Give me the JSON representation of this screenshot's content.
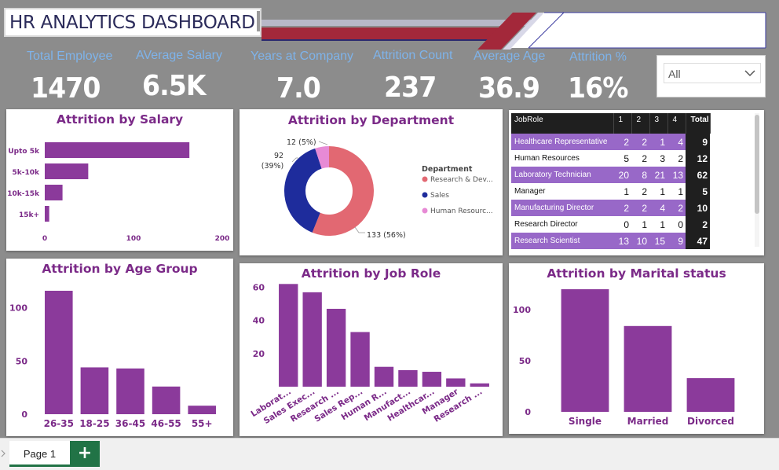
{
  "header": {
    "title": "HR ANALYTICS DASHBOARD"
  },
  "kpis": [
    {
      "label": "Total Employee",
      "value": "1470"
    },
    {
      "label": "AVerage Salary",
      "value": "6.5K"
    },
    {
      "label": "Years at Company",
      "value": "7.0"
    },
    {
      "label": "Attrition Count",
      "value": "237"
    },
    {
      "label": "Average  Age",
      "value": "36.9"
    },
    {
      "label": "Attrition %",
      "value": "16%"
    }
  ],
  "slicer": {
    "selected": "All",
    "icon": "chevron-down-icon"
  },
  "colors": {
    "bar": "#8b3a9b",
    "title": "#7b2a88",
    "rnd": "#e26872",
    "sales": "#1e2c9c",
    "hr": "#e78ad5",
    "accent_red": "#a3283a"
  },
  "salary_chart": {
    "chart_data": {
      "type": "bar",
      "orientation": "horizontal",
      "title": "Attrition by Salary",
      "categories": [
        "Upto 5k",
        "5k-10k",
        "10k-15k",
        "15k+"
      ],
      "values": [
        163,
        49,
        20,
        5
      ],
      "xlim": [
        0,
        200
      ],
      "ticks": [
        "0",
        "100",
        "200"
      ],
      "xlabel": "",
      "ylabel": ""
    }
  },
  "department_chart": {
    "chart_data": {
      "type": "pie",
      "donut": true,
      "title": "Attrition by Department",
      "legend_title": "Department",
      "categories": [
        "Research & Dev...",
        "Sales",
        "Human Resourc..."
      ],
      "values": [
        133,
        92,
        12
      ],
      "data_labels": [
        "133 (56%)",
        "92\n(39%)",
        "12 (5%)"
      ],
      "legend_position": "right"
    }
  },
  "jobrole_table": {
    "chart_data": {
      "type": "table",
      "columns": [
        "JobRole",
        "1",
        "2",
        "3",
        "4",
        "Total"
      ],
      "rows": [
        [
          "Healthcare Representative",
          "2",
          "2",
          "1",
          "4",
          "9"
        ],
        [
          "Human Resources",
          "5",
          "2",
          "3",
          "2",
          "12"
        ],
        [
          "Laboratory Technician",
          "20",
          "8",
          "21",
          "13",
          "62"
        ],
        [
          "Manager",
          "1",
          "2",
          "1",
          "1",
          "5"
        ],
        [
          "Manufacturing Director",
          "2",
          "2",
          "4",
          "2",
          "10"
        ],
        [
          "Research Director",
          "0",
          "1",
          "1",
          "0",
          "2"
        ],
        [
          "Research Scientist",
          "13",
          "10",
          "15",
          "9",
          "47"
        ]
      ]
    }
  },
  "age_chart": {
    "chart_data": {
      "type": "bar",
      "title": "Attrition by Age Group",
      "categories": [
        "26-35",
        "18-25",
        "36-45",
        "46-55",
        "55+"
      ],
      "values": [
        116,
        44,
        43,
        26,
        8
      ],
      "ylim": [
        0,
        130
      ],
      "ticks": [
        "0",
        "50",
        "100"
      ],
      "xlabel": "",
      "ylabel": ""
    }
  },
  "role_chart": {
    "chart_data": {
      "type": "bar",
      "title": "Attrition by Job Role",
      "categories": [
        "Laborat...",
        "Sales Exec...",
        "Research ...",
        "Sales Rep...",
        "Human R...",
        "Manufact...",
        "Healthcar...",
        "Manager",
        "Research ..."
      ],
      "values": [
        62,
        57,
        47,
        33,
        12,
        10,
        9,
        5,
        2
      ],
      "ylim": [
        0,
        65
      ],
      "ticks": [
        "20",
        "40",
        "60"
      ],
      "xlabel": "",
      "ylabel": ""
    }
  },
  "marital_chart": {
    "chart_data": {
      "type": "bar",
      "title": "Attrition by Marital status",
      "categories": [
        "Single",
        "Married",
        "Divorced"
      ],
      "values": [
        120,
        84,
        33
      ],
      "ylim": [
        0,
        130
      ],
      "ticks": [
        "0",
        "50",
        "100"
      ],
      "xlabel": "",
      "ylabel": ""
    }
  },
  "tabs": {
    "page_label": "Page 1",
    "add_label": "+"
  }
}
